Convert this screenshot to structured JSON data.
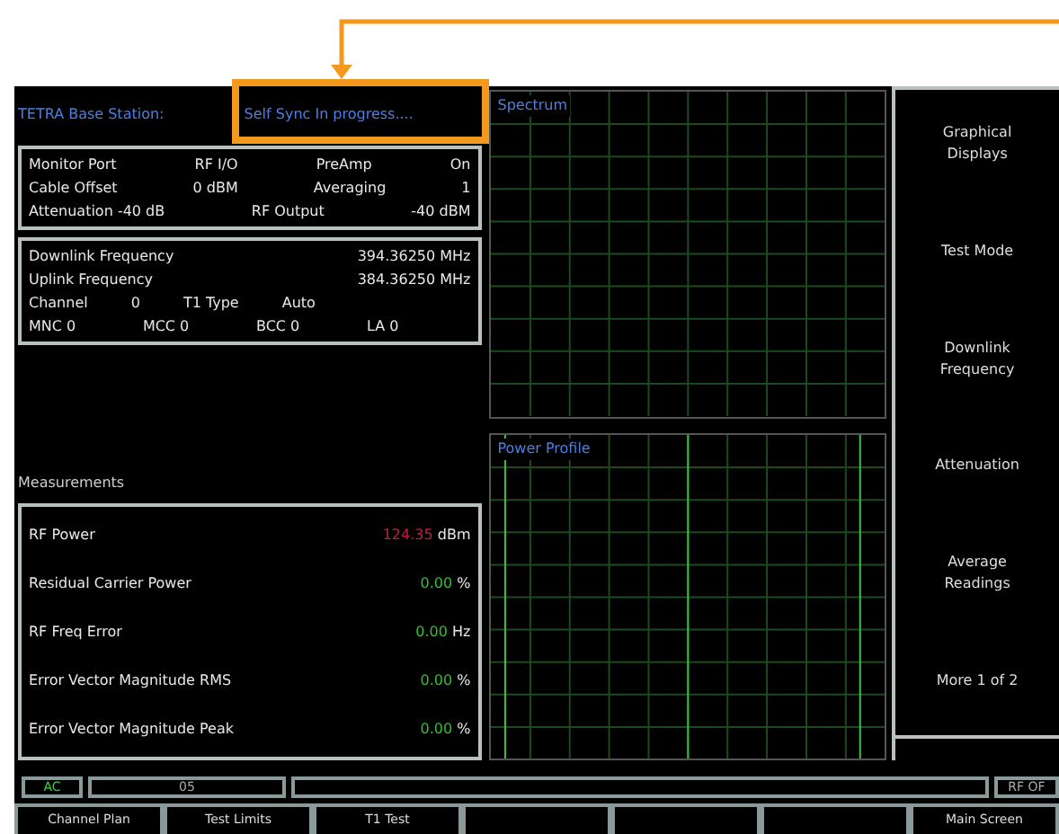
{
  "header": {
    "title": "TETRA Base Station:",
    "status": "Self Sync In progress...."
  },
  "settings": [
    [
      "Monitor Port",
      "RF I/O",
      "PreAmp",
      "On"
    ],
    [
      "Cable Offset",
      "0  dBM",
      "Averaging",
      "1"
    ],
    [
      "Attenuation -40 dB",
      "RF Output",
      "-40  dBM"
    ]
  ],
  "frequencies": [
    {
      "label": "Downlink Frequency",
      "value": "394.36250 MHz"
    },
    {
      "label": "Uplink Frequency",
      "value": "384.36250 MHz"
    }
  ],
  "channel_row": [
    "Channel",
    "0",
    "T1 Type",
    "Auto"
  ],
  "network_row": [
    "MNC 0",
    "MCC 0",
    "BCC 0",
    "LA 0"
  ],
  "measurements_title": "Measurements",
  "measurements": [
    {
      "name": "RF Power",
      "value": "124.35",
      "unit": "dBm",
      "color": "#c0203a"
    },
    {
      "name": "Residual Carrier Power",
      "value": "0.00",
      "unit": "%",
      "color": "#30c030"
    },
    {
      "name": "RF Freq Error",
      "value": "0.00",
      "unit": "Hz",
      "color": "#30c030"
    },
    {
      "name": "Error Vector Magnitude RMS",
      "value": "0.00",
      "unit": "%",
      "color": "#30c030"
    },
    {
      "name": "Error Vector Magnitude Peak",
      "value": "0.00",
      "unit": "%",
      "color": "#30c030"
    }
  ],
  "graphs": [
    {
      "title": "Spectrum",
      "kind": "spectrum"
    },
    {
      "title": "Power Profile",
      "kind": "profile"
    }
  ],
  "softkeys": [
    "Graphical Displays",
    "Test Mode",
    "Downlink Frequency",
    "Attenuation",
    "Average Readings",
    "More 1 of 2"
  ],
  "status_bar": {
    "power": "AC",
    "field": "05",
    "rf_state": "RF OF"
  },
  "bottom_keys": [
    {
      "kind": "label",
      "label": "Channel Plan"
    },
    {
      "kind": "label",
      "label": "Test Limits"
    },
    {
      "kind": "label",
      "label": "T1 Test"
    },
    {
      "kind": "blank"
    },
    {
      "kind": "blank"
    },
    {
      "kind": "blank"
    },
    {
      "kind": "label",
      "label": "Main Screen"
    }
  ]
}
